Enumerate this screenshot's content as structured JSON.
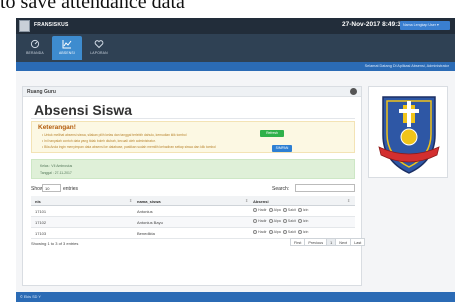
{
  "caption": {
    "text": "to save attendance data"
  },
  "navbar": {
    "brand": "FRANSISKUS",
    "datetime": "27-Nov-2017 8:49:39 AM",
    "user_button": "Nama Lengkap User ▾"
  },
  "tabs": [
    {
      "label": "BERANDA",
      "icon": "gauge-icon",
      "active": false
    },
    {
      "label": "ABSENSI",
      "icon": "chart-icon",
      "active": true
    },
    {
      "label": "LAPORAN",
      "icon": "heart-icon",
      "active": false
    }
  ],
  "subbar": {
    "welcome": "Selamat Datang Di Aplikasi Absensi, Administrator"
  },
  "panel": {
    "heading": "Ruang Guru",
    "title": "Absensi Siswa",
    "note": {
      "title": "Keterangan!",
      "lines": [
        "• Untuk melihat absensi siswa, silakan pilih kelas dan tanggal terlebih dahulu, kemudian klik tombol",
        "• Ini hanyalah contoh data yang tidak boleh diubah, kecuali oleh administrator.",
        "• Bila Anda ingin menyimpan data absensi ke database, pastikan sudah memilih kehadiran setiap siswa dan klik tombol"
      ],
      "btn_green": "Refresh",
      "btn_blue": "SIMPAN"
    },
    "info": {
      "lines": [
        "Kelas : VII Ambrosius",
        "Tanggal : 27-11-2017"
      ]
    },
    "show_label": "Show",
    "entries_value": "10",
    "entries_suffix": "entries",
    "search_label": "Search:",
    "table": {
      "headers": [
        "nis",
        "nama_siswa",
        "Absensi"
      ],
      "rows": [
        {
          "nis": "17101",
          "name": "Antonius"
        },
        {
          "nis": "17102",
          "name": "Antonius Bayu"
        },
        {
          "nis": "17103",
          "name": "Benedikta"
        }
      ],
      "radio_options": [
        "Hadir",
        "Alpa",
        "Sakit",
        "Izin"
      ]
    },
    "footer_info": "Showing 1 to 3 of 3 entries",
    "pager": [
      "First",
      "Previous",
      "1",
      "Next",
      "Last"
    ]
  },
  "bottombar": {
    "text": "© Ekis SD Y"
  },
  "colors": {
    "navbar": "#222d3a",
    "accent": "#2b6bb5",
    "success": "#2fb14b",
    "warning_bg": "#fcf8e3"
  }
}
